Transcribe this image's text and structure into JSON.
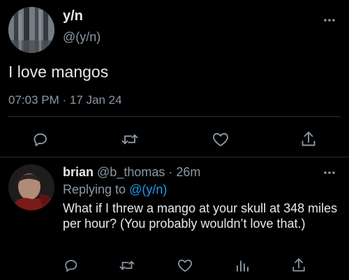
{
  "tweet": {
    "display_name": "y/n",
    "handle": "@(y/n)",
    "text": "I love mangos",
    "timestamp": "07:03 PM · 17 Jan 24",
    "actions": [
      "reply-icon",
      "retweet-icon",
      "like-icon",
      "share-icon"
    ]
  },
  "reply": {
    "display_name": "brian",
    "handle": "@b_thomas",
    "separator": "·",
    "time_ago": "26m",
    "replying_prefix": "Replying to",
    "replying_handle": "@(y/n)",
    "text": "What if I threw a mango at your skull at 348 miles per hour? (You probably wouldn’t love that.)",
    "actions": [
      "reply-icon",
      "retweet-icon",
      "like-icon",
      "analytics-icon",
      "share-icon"
    ]
  },
  "colors": {
    "background": "#000000",
    "text_primary": "#e7e9ea",
    "text_secondary": "#8b98a5",
    "link": "#1d9bf0",
    "divider": "#2a2e33"
  }
}
